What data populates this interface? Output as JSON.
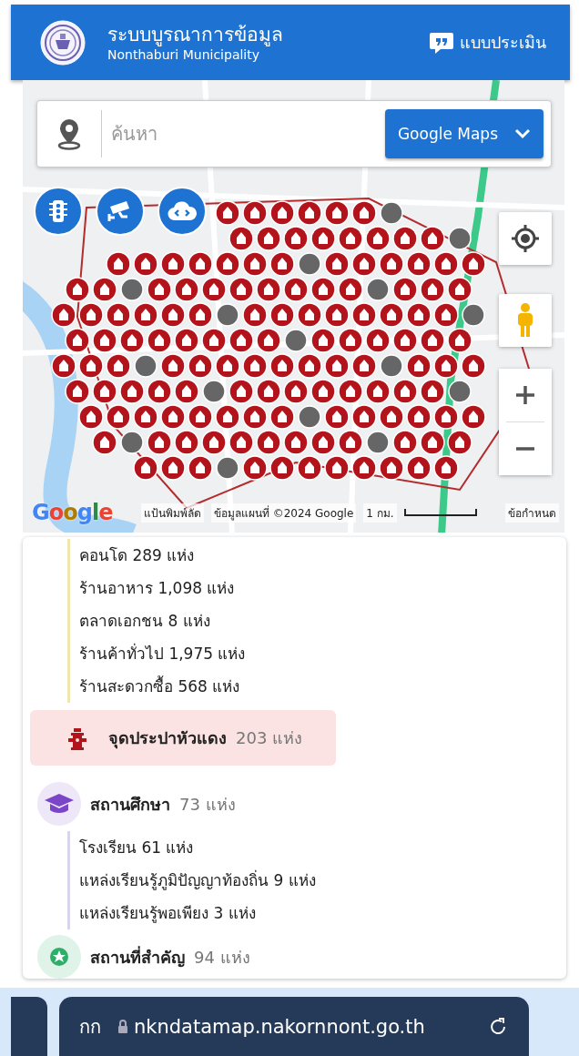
{
  "header": {
    "title": "ระบบบูรณาการข้อมูล",
    "subtitle": "Nonthaburi Municipality",
    "survey_button": "แบบประเมิน"
  },
  "map": {
    "search": {
      "placeholder": "ค้นหา"
    },
    "map_type": "Google Maps",
    "logo": "Google",
    "attribution": [
      "แป้นพิมพ์ลัด",
      "ข้อมูลแผนที่ ©2024 Google",
      "1 กม.",
      "ข้อกำหนด"
    ]
  },
  "categories": [
    {
      "items": [
        "คอนโด 289 แห่ง",
        "ร้านอาหาร 1,098 แห่ง",
        "ตลาดเอกชน 8 แห่ง",
        "ร้านค้าทั่วไป 1,975 แห่ง",
        "ร้านสะดวกซื้อ 568 แห่ง"
      ],
      "kind": "store"
    },
    {
      "name": "จุดประปาหัวแดง",
      "count": "203 แห่ง",
      "selected": true,
      "kind": "hydrant"
    },
    {
      "name": "สถานศึกษา",
      "count": "73 แห่ง",
      "selected": false,
      "kind": "school",
      "items": [
        "โรงเรียน 61 แห่ง",
        "แหล่งเรียนรู้ภูมิปัญญาท้องถิ่น 9 แห่ง",
        "แหล่งเรียนรู้พอเพียง 3 แห่ง"
      ]
    },
    {
      "name": "สถานที่สำคัญ",
      "count": "94 แห่ง",
      "selected": false,
      "kind": "landmark"
    }
  ],
  "browser": {
    "text_size": "กก",
    "url": "nkndatamap.nakornnont.go.th"
  }
}
